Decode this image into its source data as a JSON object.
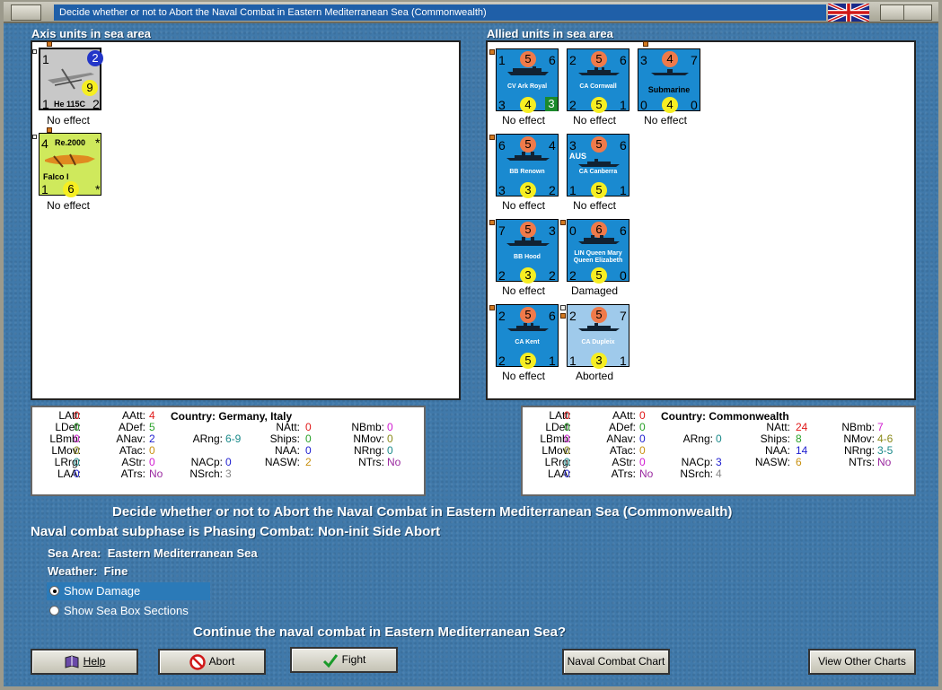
{
  "window": {
    "title": "Decide whether or not to Abort the Naval Combat in Eastern Mediterranean Sea (Commonwealth)"
  },
  "axis": {
    "label": "Axis units in sea area",
    "units": [
      {
        "top_left": "1",
        "top_right": "2",
        "mid": "9",
        "bottom_left": "1",
        "bottom_right": "2",
        "name": "He 115C",
        "status": "No effect"
      },
      {
        "top_left": "4",
        "top_name": "Re.2000",
        "top_right": "*",
        "name": "Falco I",
        "bottom_left": "1",
        "mid": "6",
        "bottom_right": "*",
        "status": "No effect"
      }
    ]
  },
  "allied": {
    "label": "Allied units in sea area",
    "units": [
      {
        "tl": "1",
        "tc": "5",
        "tr": "6",
        "name": "CV Ark Royal",
        "bl": "3",
        "bc": "4",
        "br": "3",
        "status": "No effect"
      },
      {
        "tl": "2",
        "tc": "5",
        "tr": "6",
        "name": "CA Cornwall",
        "bl": "2",
        "bc": "5",
        "br": "1",
        "status": "No effect"
      },
      {
        "tl": "3",
        "tc": "4",
        "tr": "7",
        "name": "Submarine",
        "bl": "0",
        "bc": "4",
        "br": "0",
        "status": "No effect"
      },
      {
        "tl": "6",
        "tc": "5",
        "tr": "4",
        "name": "BB Renown",
        "bl": "3",
        "bc": "3",
        "br": "2",
        "status": "No effect"
      },
      {
        "tl": "3",
        "tc": "5",
        "tr": "6",
        "name": "CA Canberra",
        "nat": "AUS",
        "bl": "1",
        "bc": "5",
        "br": "1",
        "status": "No effect"
      },
      {
        "tl": "7",
        "tc": "5",
        "tr": "3",
        "name": "BB Hood",
        "bl": "2",
        "bc": "3",
        "br": "2",
        "status": "No effect"
      },
      {
        "tl": "0",
        "tc": "6",
        "tr": "6",
        "name": "LIN Queen Mary Queen Elizabeth",
        "bl": "2",
        "bc": "5",
        "br": "0",
        "status": "Damaged"
      },
      {
        "tl": "2",
        "tc": "5",
        "tr": "6",
        "name": "CA Kent",
        "bl": "2",
        "bc": "5",
        "br": "1",
        "status": "No effect"
      },
      {
        "tl": "2",
        "tc": "5",
        "tr": "7",
        "name": "CA Dupleix",
        "bl": "1",
        "bc": "3",
        "br": "1",
        "status": "Aborted"
      }
    ]
  },
  "axis_stats": {
    "country_label": "Country:",
    "country": "Germany, Italy",
    "LAtt": "0",
    "LDef": "0",
    "LBmb": "0",
    "LMov": "0",
    "LRrg": "0",
    "LAA": "0",
    "AAtt": "4",
    "ADef": "5",
    "ANav": "2",
    "ATac": "0",
    "AStr": "0",
    "ATrs": "No",
    "ARng": "6-9",
    "NACp": "0",
    "NSrch": "3",
    "NAtt": "0",
    "Ships": "0",
    "NAA": "0",
    "NASW": "2",
    "NBmb": "0",
    "NMov": "0",
    "NRng": "0",
    "NTrs": "No"
  },
  "allied_stats": {
    "country_label": "Country:",
    "country": "Commonwealth",
    "LAtt": "0",
    "LDef": "0",
    "LBmb": "0",
    "LMov": "0",
    "LRrg": "0",
    "LAA": "0",
    "AAtt": "0",
    "ADef": "0",
    "ANav": "0",
    "ATac": "0",
    "AStr": "0",
    "ATrs": "No",
    "ARng": "0",
    "NACp": "3",
    "NSrch": "4",
    "NAtt": "24",
    "Ships": "8",
    "NAA": "14",
    "NASW": "6",
    "NBmb": "7",
    "NMov": "4-6",
    "NRng": "3-5",
    "NTrs": "No"
  },
  "labels": {
    "LAtt": "LAtt:",
    "LDef": "LDef:",
    "LBmb": "LBmb:",
    "LMov": "LMov:",
    "LRrg": "LRrg:",
    "LAA": "LAA:",
    "AAtt": "AAtt:",
    "ADef": "ADef:",
    "ANav": "ANav:",
    "ATac": "ATac:",
    "AStr": "AStr:",
    "ATrs": "ATrs:",
    "ARng": "ARng:",
    "NACp": "NACp:",
    "NSrch": "NSrch:",
    "NAtt": "NAtt:",
    "Ships": "Ships:",
    "NAA": "NAA:",
    "NASW": "NASW:",
    "NBmb": "NBmb:",
    "NMov": "NMov:",
    "NRng": "NRng:",
    "NTrs": "NTrs:"
  },
  "messages": {
    "headline": "Decide whether or not to Abort the Naval Combat in Eastern Mediterranean Sea (Commonwealth)",
    "subphase": "Naval combat subphase is Phasing Combat: Non-init Side Abort",
    "sea_area_label": "Sea Area:",
    "sea_area": "Eastern Mediterranean Sea",
    "weather_label": "Weather:",
    "weather": "Fine",
    "question": "Continue the naval combat in Eastern Mediterranean Sea?"
  },
  "options": {
    "show_damage": "Show Damage",
    "show_sea_box": "Show Sea Box Sections"
  },
  "buttons": {
    "help": "Help",
    "abort": "Abort",
    "fight": "Fight",
    "naval_chart": "Naval Combat Chart",
    "other_charts": "View Other Charts"
  },
  "colors": {
    "counter_blue": "#1a8ad0",
    "counter_light": "#9fcaeb",
    "panel": "#4079aa"
  }
}
